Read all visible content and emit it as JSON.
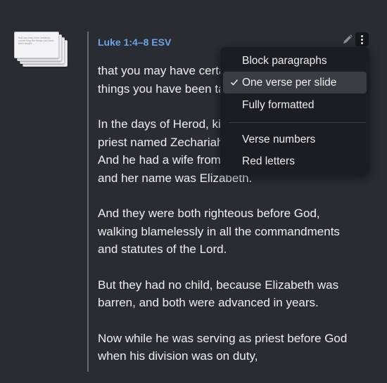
{
  "thumbnail": {
    "text": "that you may have certainty concerning the things you have been taught."
  },
  "passage": {
    "reference": "Luke 1:4–8 ESV",
    "paragraphs": [
      "that you may have certainty concerning the\nthings you have been taught.",
      "In the days of Herod, king of Judea, there was a\npriest named Zechariah, of the division of Abijah.\nAnd he had a wife from the daughters of Aaron,\nand her name was Elizabeth.",
      "And they were both righteous before God,\nwalking blamelessly in all the commandments\nand statutes of the Lord.",
      "But they had no child, because Elizabeth was\nbarren, and both were advanced in years.",
      "Now while he was serving as priest before God\nwhen his division was on duty,"
    ]
  },
  "menu": {
    "items": [
      {
        "label": "Block paragraphs",
        "checked": false
      },
      {
        "label": "One verse per slide",
        "checked": true
      },
      {
        "label": "Fully formatted",
        "checked": false
      },
      {
        "label": "Verse numbers",
        "checked": false
      },
      {
        "label": "Red letters",
        "checked": false
      }
    ]
  },
  "colors": {
    "background": "#2a2c33",
    "reference": "#6ea4e6",
    "menu_bg": "#1c1d22",
    "menu_selected": "#3a3c44"
  }
}
